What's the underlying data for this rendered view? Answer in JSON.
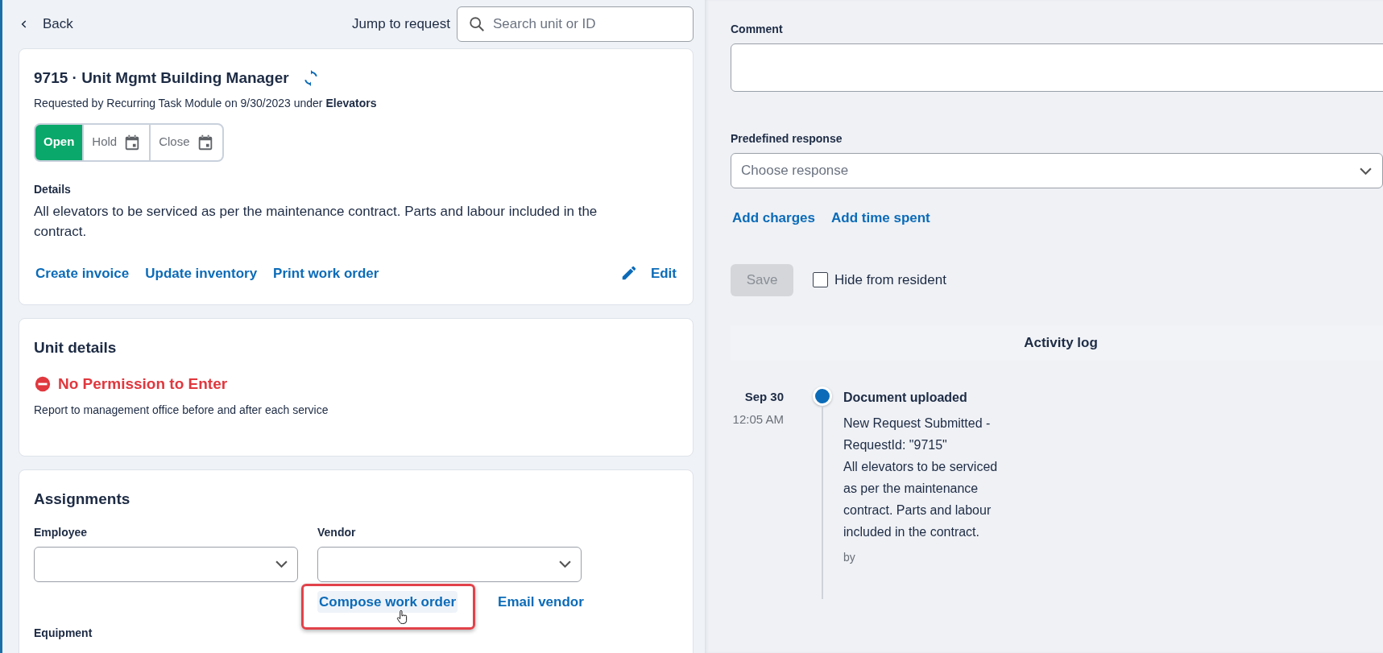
{
  "header": {
    "back": "Back",
    "jump_label": "Jump to request",
    "search": {
      "placeholder": "Search unit or ID"
    }
  },
  "request": {
    "title": "9715 · Unit Mgmt Building Manager",
    "subtitle": "Requested by Recurring Task Module on 9/30/2023 under **Elevators**",
    "statuses": [
      {
        "label": "Open",
        "selected": true,
        "kind": "plain"
      },
      {
        "label": "Hold",
        "selected": false,
        "kind": "dated"
      },
      {
        "label": "Close",
        "selected": false,
        "kind": "dated"
      }
    ],
    "details_label": "Details",
    "details": "All elevators to be serviced as per the maintenance contract. Parts and labour included in the contract.",
    "actions": [
      "Create invoice",
      "Update inventory",
      "Print work order"
    ],
    "edit": "Edit"
  },
  "unit_details": {
    "title": "Unit details",
    "alert": "No Permission to Enter",
    "note": "Report to management office before and after each service"
  },
  "assignments": {
    "title": "Assignments",
    "fields": [
      {
        "label": "Employee"
      },
      {
        "label": "Vendor"
      }
    ],
    "actions": [
      {
        "label": "Compose work order",
        "highlighted": true
      },
      {
        "label": "Email vendor",
        "highlighted": false
      }
    ],
    "next_label": "Equipment"
  },
  "comment": {
    "label": "Comment"
  },
  "predefined": {
    "label": "Predefined response",
    "placeholder": "Choose response"
  },
  "links": [
    "Add charges",
    "Add time spent"
  ],
  "save": {
    "label": "Save",
    "disabled": true
  },
  "hide": {
    "label": "Hide from resident",
    "checked": false
  },
  "activity": {
    "title": "Activity log",
    "entries": [
      {
        "date": "Sep 30",
        "time": "12:05 AM",
        "title": "Document uploaded",
        "paragraphs": [
          "New Request Submitted - RequestId: \"9715\"",
          "All elevators to be serviced as per the maintenance contract. Parts and labour included in the contract."
        ],
        "by": "by"
      }
    ]
  }
}
